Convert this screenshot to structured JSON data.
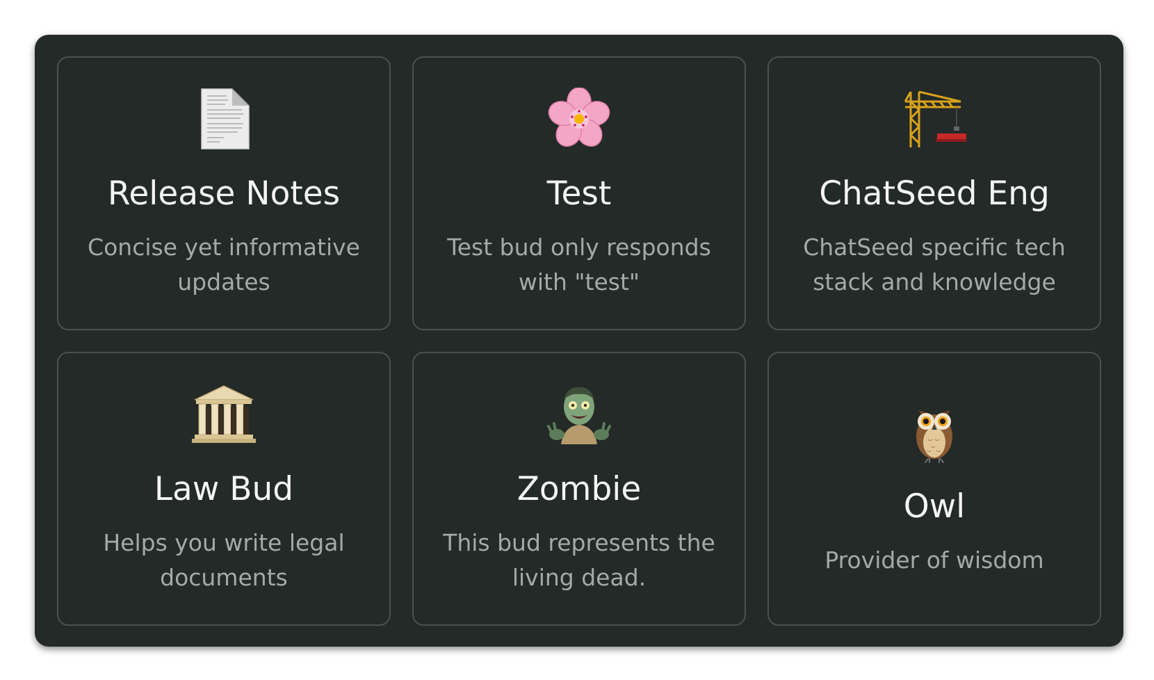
{
  "buds": [
    {
      "icon": "document-icon",
      "title": "Release Notes",
      "description": "Concise yet informative updates"
    },
    {
      "icon": "cherry-blossom-icon",
      "title": "Test",
      "description": "Test bud only responds with \"test\""
    },
    {
      "icon": "construction-crane-icon",
      "title": "ChatSeed Eng",
      "description": "ChatSeed specific tech stack and knowledge"
    },
    {
      "icon": "classical-building-icon",
      "title": "Law Bud",
      "description": "Helps you write legal documents"
    },
    {
      "icon": "zombie-icon",
      "title": "Zombie",
      "description": "This bud represents the living dead."
    },
    {
      "icon": "owl-icon",
      "title": "Owl",
      "description": "Provider of wisdom"
    }
  ],
  "colors": {
    "panel_background": "#232a27",
    "card_border": "#4a514e",
    "title_text": "#f4f5f4",
    "description_text": "#a5aaa7"
  }
}
